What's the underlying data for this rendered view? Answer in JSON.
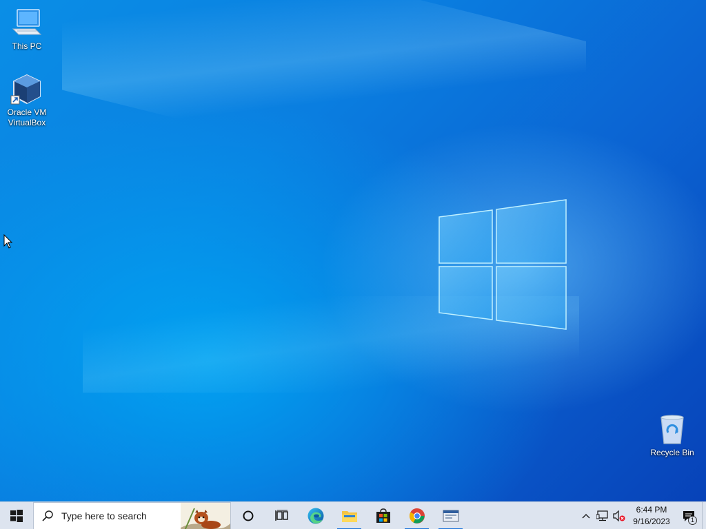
{
  "desktop": {
    "icons": [
      {
        "label": "This PC",
        "icon": "this-pc-icon"
      },
      {
        "label": "Oracle VM VirtualBox",
        "label_lines": [
          "Oracle VM",
          "VirtualBox"
        ],
        "icon": "virtualbox-icon"
      },
      {
        "label": "Recycle Bin",
        "icon": "recycle-bin-icon"
      }
    ]
  },
  "taskbar": {
    "start_icon": "windows-start-icon",
    "search": {
      "placeholder": "Type here to search",
      "icon": "search-icon"
    },
    "pinned": [
      {
        "name": "cortana",
        "icon": "cortana-circle-icon",
        "active": false
      },
      {
        "name": "task-view",
        "icon": "task-view-icon",
        "active": false
      },
      {
        "name": "edge",
        "icon": "edge-icon",
        "active": false
      },
      {
        "name": "file-explorer",
        "icon": "folder-icon",
        "active": true
      },
      {
        "name": "microsoft-store",
        "icon": "store-icon",
        "active": false
      },
      {
        "name": "chrome",
        "icon": "chrome-icon",
        "active": true
      },
      {
        "name": "app-window",
        "icon": "app-window-icon",
        "active": true
      }
    ],
    "tray": {
      "icons": [
        "chevron-up-icon",
        "network-icon",
        "volume-muted-icon"
      ],
      "time": "6:44 PM",
      "date": "9/16/2023",
      "notification_count": "1"
    }
  },
  "colors": {
    "wallpaper_accent": "#0a7ee0",
    "taskbar_bg": "#dde4ef",
    "active_indicator": "#1a73d9"
  }
}
